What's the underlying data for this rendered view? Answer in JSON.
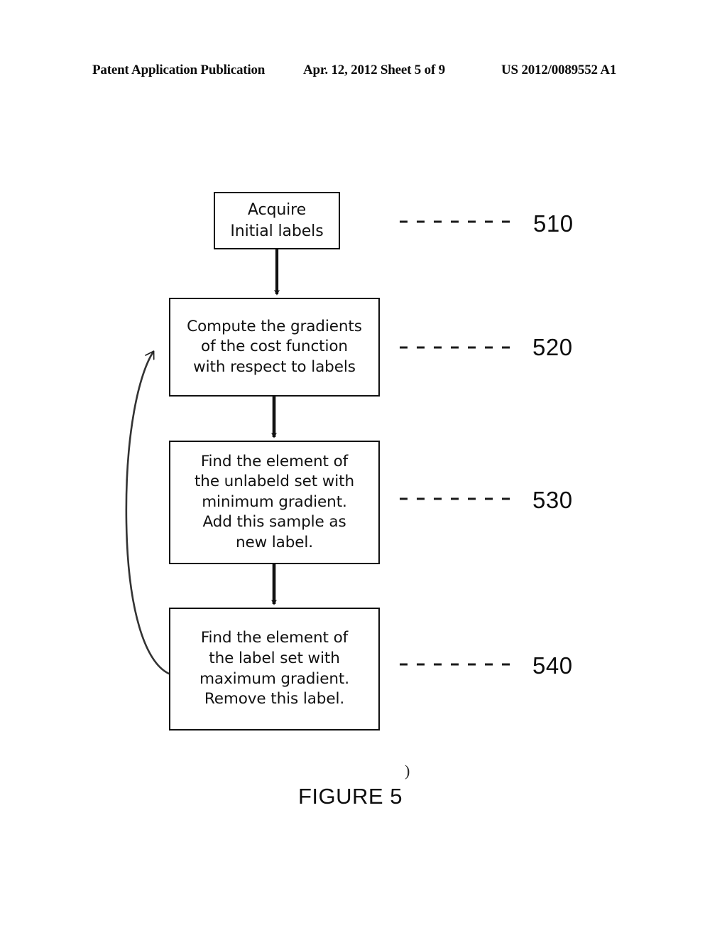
{
  "header": {
    "left": "Patent Application Publication",
    "center": "Apr. 12, 2012  Sheet 5 of 9",
    "right": "US 2012/0089552 A1"
  },
  "figure": {
    "caption": "FIGURE 5",
    "stray_mark": ")",
    "line_color": "#111111",
    "box_fill": "#ffffff",
    "background": "#ffffff"
  },
  "flowchart": {
    "type": "flowchart",
    "orientation": "top-to-bottom",
    "steps": [
      {
        "ref": "510",
        "text": "Acquire\nInitial labels"
      },
      {
        "ref": "520",
        "text": "Compute the gradients\nof the cost function\nwith respect to labels"
      },
      {
        "ref": "530",
        "text": "Find the element of\nthe unlabeld set with\nminimum gradient.\nAdd this sample as\nnew label."
      },
      {
        "ref": "540",
        "text": "Find the element of\nthe label set with\nmaximum gradient.\nRemove this label."
      }
    ],
    "connectors": [
      {
        "from": "510",
        "to": "520",
        "style": "solid-arrow-down"
      },
      {
        "from": "520",
        "to": "530",
        "style": "solid-arrow-down"
      },
      {
        "from": "530",
        "to": "540",
        "style": "solid-arrow-down"
      },
      {
        "from": "540",
        "to": "520",
        "style": "curved-feedback-arrow-left"
      }
    ],
    "leader_lines": [
      {
        "ref": "510",
        "style": "dashed"
      },
      {
        "ref": "520",
        "style": "dashed"
      },
      {
        "ref": "530",
        "style": "dashed"
      },
      {
        "ref": "540",
        "style": "dashed"
      }
    ]
  }
}
